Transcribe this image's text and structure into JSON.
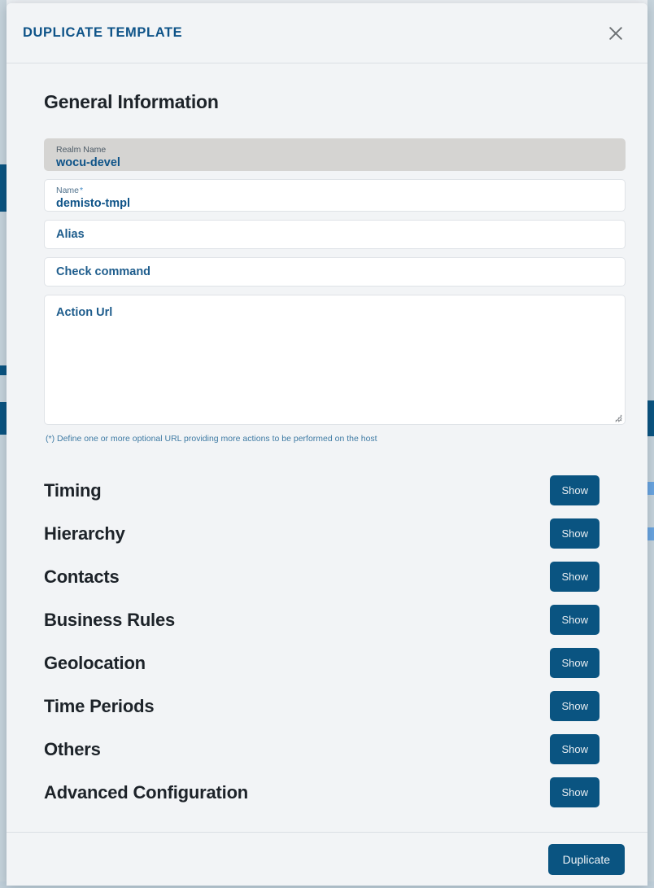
{
  "modal": {
    "title": "DUPLICATE TEMPLATE",
    "close_icon": "close-icon"
  },
  "general": {
    "heading": "General Information",
    "fields": [
      {
        "name": "realm-name",
        "label": "Realm Name",
        "value": "wocu-devel",
        "required": false,
        "disabled": true,
        "type": "text"
      },
      {
        "name": "name",
        "label": "Name",
        "value": "demisto-tmpl",
        "required": true,
        "disabled": false,
        "type": "text"
      },
      {
        "name": "alias",
        "label": "",
        "placeholder": "Alias",
        "value": "",
        "required": false,
        "disabled": false,
        "type": "text"
      },
      {
        "name": "check-command",
        "label": "",
        "placeholder": "Check command",
        "value": "",
        "required": false,
        "disabled": false,
        "type": "text"
      },
      {
        "name": "action-url",
        "label": "",
        "placeholder": "Action Url",
        "value": "",
        "required": false,
        "disabled": false,
        "type": "textarea"
      }
    ],
    "helper_text": "(*) Define one or more optional URL providing more actions to be performed on the host"
  },
  "sections": [
    {
      "label": "Timing",
      "button": "Show"
    },
    {
      "label": "Hierarchy",
      "button": "Show"
    },
    {
      "label": "Contacts",
      "button": "Show"
    },
    {
      "label": "Business Rules",
      "button": "Show"
    },
    {
      "label": "Geolocation",
      "button": "Show"
    },
    {
      "label": "Time Periods",
      "button": "Show"
    },
    {
      "label": "Others",
      "button": "Show"
    },
    {
      "label": "Advanced Configuration",
      "button": "Show"
    }
  ],
  "footer": {
    "primary_button": "Duplicate"
  },
  "colors": {
    "accent": "#0a5481",
    "title": "#0e5388",
    "modal_bg": "#f2f4f6",
    "field_bg": "#ffffff",
    "field_disabled_bg": "#d5d4d2",
    "heading": "#1d2329",
    "helper": "#3f7ba4"
  }
}
